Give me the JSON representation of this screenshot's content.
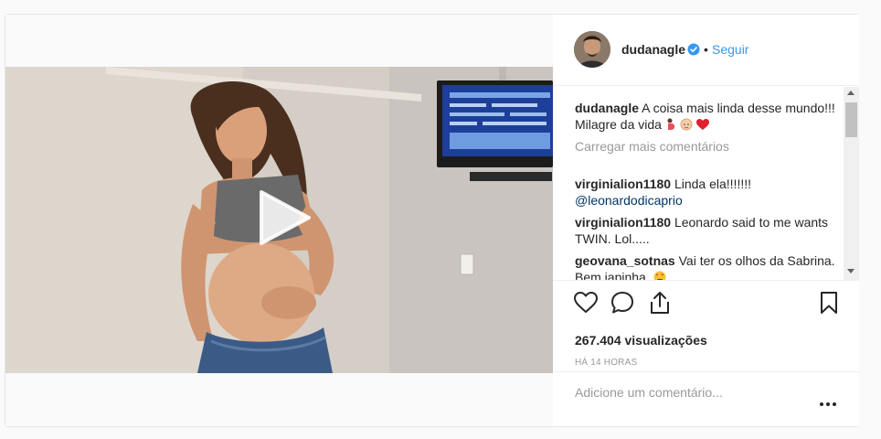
{
  "post": {
    "author": "dudanagle",
    "separator": "•",
    "follow_label": "Seguir",
    "views_label": "267.404 visualizações",
    "time_label": "HÁ 14 HORAS",
    "add_comment_placeholder": "Adicione um comentário...",
    "load_more_label": "Carregar mais comentários"
  },
  "caption": {
    "user": "dudanagle",
    "text": "A coisa mais linda desse mundo!!! Milagre da vida"
  },
  "comments": [
    {
      "user": "virginialion1180",
      "text": "Linda ela!!!!!!!",
      "mention": "@leonardodicaprio"
    },
    {
      "user": "virginialion1180",
      "text": "Leonardo said to me wants TWIN. Lol....."
    },
    {
      "user": "geovana_sotnas",
      "text": "Vai ter os olhos da Sabrina. Bem japinha."
    }
  ],
  "colors": {
    "link": "#3897f0",
    "verified": "#3897f0",
    "muted": "#999999",
    "heart": "#ed4956"
  },
  "icons": {
    "like": "heart-outline-icon",
    "comment": "speech-bubble-icon",
    "share": "share-icon",
    "save": "bookmark-icon",
    "more": "ellipsis-icon",
    "play": "play-icon",
    "verified": "verified-badge-icon"
  }
}
